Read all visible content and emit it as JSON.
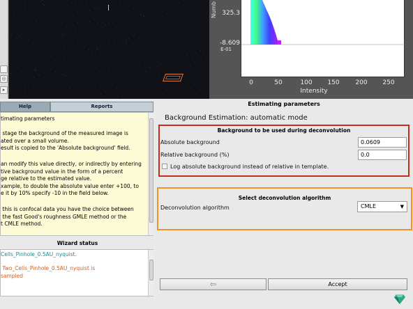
{
  "histogram": {
    "ylabel": "Numb",
    "yticks": [
      "325.3",
      "-8.609",
      "E-01"
    ],
    "xticks": [
      "0",
      "50",
      "100",
      "150",
      "200",
      "250"
    ],
    "xlabel": "Intensity"
  },
  "tabs": {
    "help": "Help",
    "reports": "Reports"
  },
  "help": {
    "lines": [
      "timating parameters",
      "",
      " stage the background of the measured image is",
      "ated over a small volume.",
      "esult is copied to the 'Absolute background' field.",
      "",
      "an modify this value directly, or indirectly by entering",
      "tive background value in the form of a percent",
      "ge relative to the estimated value.",
      "xample, to double the absolute value enter +100, to",
      "e it by 10% specify -10 in the field below.",
      "",
      " this is confocal data you have the choice between",
      " the fast Good's roughness GMLE method or the",
      "t CMLE method."
    ]
  },
  "wizard": {
    "title": "Wizard status",
    "line1": "Cells_Pinhole_0.5AU_nyquist.",
    "line2": " Two_Cells_Pinhole_0.5AU_nyquist is",
    "line3": "sampled"
  },
  "estimation": {
    "title": "Estimating parameters",
    "subtitle": "Background Estimation: automatic mode"
  },
  "background": {
    "title": "Background to be used during deconvolution",
    "absolute_label": "Absolute background",
    "absolute_value": "0.0609",
    "relative_label": "Relative background (%)",
    "relative_value": "0.0",
    "log_label": "Log absolute background instead of relative in template."
  },
  "algorithm": {
    "title": "Select deconvolution algorithm",
    "label": "Deconvolution algorithm",
    "value": "CMLE"
  },
  "buttons": {
    "back": "⇦",
    "accept": "Accept"
  },
  "colors": {
    "bg_box": "#c0301a",
    "algo_box": "#f0952a"
  }
}
